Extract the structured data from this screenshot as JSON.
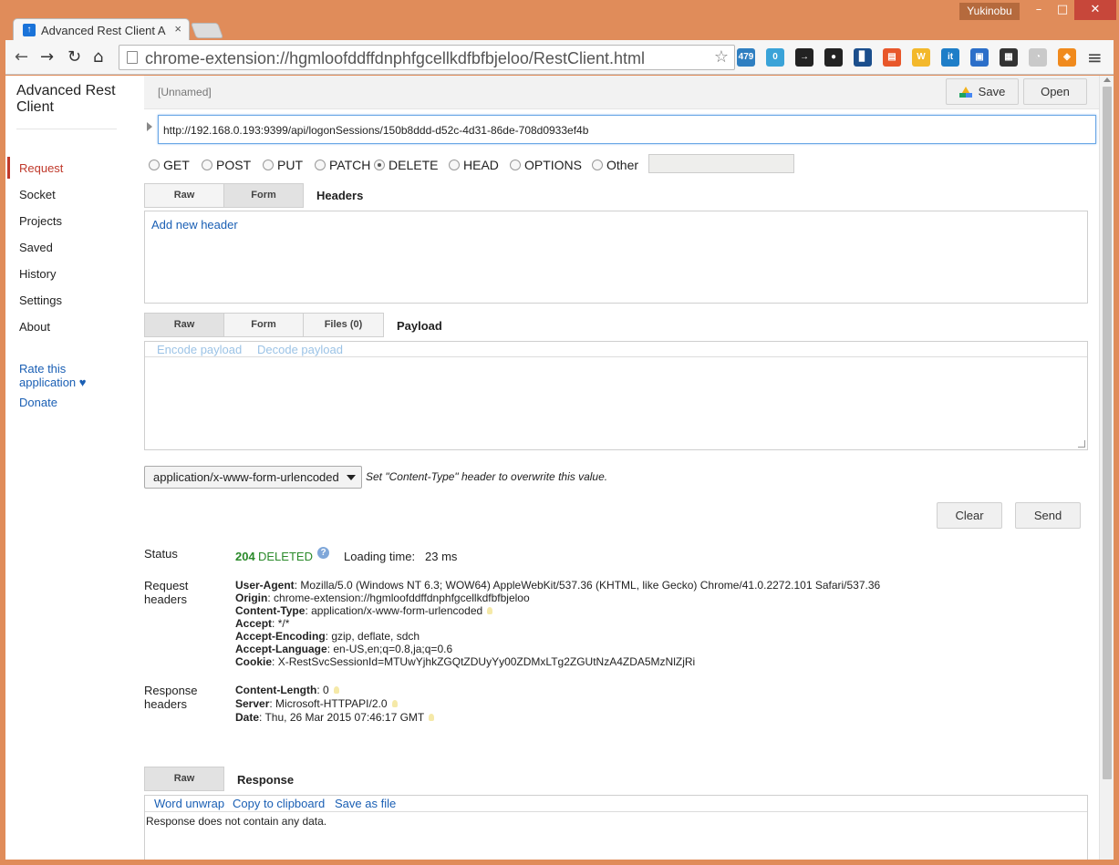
{
  "window": {
    "user": "Yukinobu",
    "minimize": "–",
    "maximize": "□",
    "close": "✕"
  },
  "tab": {
    "title": "Advanced Rest Client A",
    "close": "×"
  },
  "toolbar": {
    "back": "←",
    "forward": "→",
    "reload": "↻",
    "home": "⌂",
    "address": "chrome-extension://hgmloofddffdnphfgcellkdfbfbjeloo/RestClient.html",
    "bookmark_star": "☆",
    "menu": "≡",
    "extensions": [
      {
        "name": "bird-extension-icon",
        "label": "479",
        "color": "#2f7fc1"
      },
      {
        "name": "twitter-extension-icon",
        "label": "0",
        "color": "#3aa3d8"
      },
      {
        "name": "send-to-phone-icon",
        "label": "→",
        "color": "#222222"
      },
      {
        "name": "color-wheel-icon",
        "label": "●",
        "color": "#222222"
      },
      {
        "name": "analytics-icon",
        "label": "▊",
        "color": "#1b4e8c"
      },
      {
        "name": "cart-icon",
        "label": "▤",
        "color": "#e8572a"
      },
      {
        "name": "w-extension-icon",
        "label": "W",
        "color": "#f3b82b"
      },
      {
        "name": "it-extension-icon",
        "label": "it",
        "color": "#1e7ec8"
      },
      {
        "name": "window-extension-icon",
        "label": "▣",
        "color": "#2c6fc9"
      },
      {
        "name": "film-extension-icon",
        "label": "▦",
        "color": "#333333"
      },
      {
        "name": "speed-extension-icon",
        "label": "◔",
        "color": "#c9c9c9"
      },
      {
        "name": "share-extension-icon",
        "label": "◈",
        "color": "#f08a1d"
      }
    ]
  },
  "sidebar": {
    "title": "Advanced Rest Client",
    "items": [
      "Request",
      "Socket",
      "Projects",
      "Saved",
      "History",
      "Settings",
      "About"
    ],
    "rate": "Rate this application ♥",
    "donate": "Donate"
  },
  "request": {
    "name": "[Unnamed]",
    "save_label": "Save",
    "open_label": "Open",
    "url": "http://192.168.0.193:9399/api/logonSessions/150b8ddd-d52c-4d31-86de-708d0933ef4b",
    "methods": [
      "GET",
      "POST",
      "PUT",
      "PATCH",
      "DELETE",
      "HEAD",
      "OPTIONS",
      "Other"
    ],
    "selected_method": "DELETE",
    "other_value": ""
  },
  "headers_section": {
    "tabs": [
      "Raw",
      "Form"
    ],
    "selected_tab": "Form",
    "title": "Headers",
    "add_link": "Add new header"
  },
  "payload_section": {
    "tabs": [
      "Raw",
      "Form",
      "Files (0)"
    ],
    "selected_tab": "Raw",
    "title": "Payload",
    "encode": "Encode payload",
    "decode": "Decode payload",
    "value": ""
  },
  "content_type": {
    "value": "application/x-www-form-urlencoded",
    "hint": "Set \"Content-Type\" header to overwrite this value."
  },
  "actions": {
    "clear": "Clear",
    "send": "Send"
  },
  "result": {
    "status_label": "Status",
    "status_code": "204",
    "status_text": "DELETED",
    "help": "?",
    "loading_label": "Loading time:",
    "loading_value": "23 ms",
    "request_headers_label": "Request headers",
    "request_headers": [
      {
        "key": "User-Agent",
        "value": "Mozilla/5.0 (Windows NT 6.3; WOW64) AppleWebKit/537.36 (KHTML, like Gecko) Chrome/41.0.2272.101 Safari/537.36"
      },
      {
        "key": "Origin",
        "value": "chrome-extension://hgmloofddffdnphfgcellkdfbfbjeloo"
      },
      {
        "key": "Content-Type",
        "value": "application/x-www-form-urlencoded"
      },
      {
        "key": "Accept",
        "value": "*/*"
      },
      {
        "key": "Accept-Encoding",
        "value": "gzip, deflate, sdch"
      },
      {
        "key": "Accept-Language",
        "value": "en-US,en;q=0.8,ja;q=0.6"
      },
      {
        "key": "Cookie",
        "value": "X-RestSvcSessionId=MTUwYjhkZGQtZDUyYy00ZDMxLTg2ZGUtNzA4ZDA5MzNlZjRi"
      }
    ],
    "response_headers_label": "Response headers",
    "response_headers": [
      {
        "key": "Content-Length",
        "value": "0"
      },
      {
        "key": "Server",
        "value": "Microsoft-HTTPAPI/2.0"
      },
      {
        "key": "Date",
        "value": "Thu, 26 Mar 2015 07:46:17 GMT"
      }
    ]
  },
  "response_section": {
    "tab": "Raw",
    "title": "Response",
    "word_unwrap": "Word unwrap",
    "copy": "Copy to clipboard",
    "save_file": "Save as file",
    "body": "Response does not contain any data."
  }
}
